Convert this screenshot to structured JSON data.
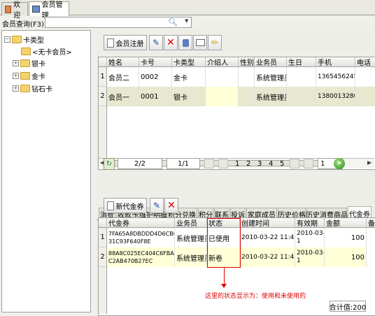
{
  "tabs": [
    {
      "label": "欢迎"
    },
    {
      "label": "会员管理"
    }
  ],
  "search": {
    "label": "会员查询(F3):",
    "value": ""
  },
  "tree": {
    "root": "卡类型",
    "items": [
      "<无卡会员>",
      "银卡",
      "金卡",
      "钻石卡"
    ]
  },
  "toolbar": {
    "register_label": "会员注册"
  },
  "members": {
    "columns": [
      "姓名",
      "卡号",
      "卡类型",
      "介绍人",
      "性别",
      "业务员",
      "生日",
      "手机",
      "电话"
    ],
    "rows": [
      {
        "idx": "1",
        "cells": [
          "会员二",
          "0002",
          "金卡",
          "",
          "",
          "系统管理员",
          "",
          "13654562458",
          ""
        ]
      },
      {
        "idx": "2",
        "cells": [
          "会员一",
          "0001",
          "银卡",
          "",
          "",
          "系统管理员",
          "",
          "13800132800",
          ""
        ]
      }
    ]
  },
  "pager": {
    "pages": "2/2",
    "current": "1/1",
    "numbers": [
      "1",
      "2",
      "3",
      "4",
      "5"
    ],
    "goto": "1"
  },
  "subtabs": [
    "消费",
    "收款",
    "卡维护明细",
    "积分兑换",
    "积分",
    "联系",
    "投诉",
    "家庭成员",
    "历史价格",
    "历史消费商品",
    "代金券"
  ],
  "voucher_toolbar": {
    "new_label": "新代金券"
  },
  "vouchers": {
    "columns": [
      "代金券",
      "业务员",
      "状态",
      "创建时间",
      "有效期",
      "金额",
      "备"
    ],
    "rows": [
      {
        "idx": "1",
        "code1": "7FA65A8DBDDD4D6CB66",
        "code2": "31C93F640F8E",
        "staff": "系统管理员",
        "status": "已使用",
        "created": "2010-03-22 11:46:00",
        "expiry1": "2010-03-3",
        "expiry2": "1",
        "amount": "100"
      },
      {
        "idx": "2",
        "code1": "88A8C025EC404C6FBA0",
        "code2": "C2AB470B27EC",
        "staff": "系统管理员",
        "status": "新卷",
        "created": "2010-03-22 11:46:00",
        "expiry1": "2010-03-3",
        "expiry2": "1",
        "amount": "100"
      }
    ]
  },
  "annotation": "这里的状态显示为：使用和未使用的",
  "total": "合计值:200",
  "colors": {
    "annotation": "#e00000",
    "highlight": "#ffffd8"
  }
}
